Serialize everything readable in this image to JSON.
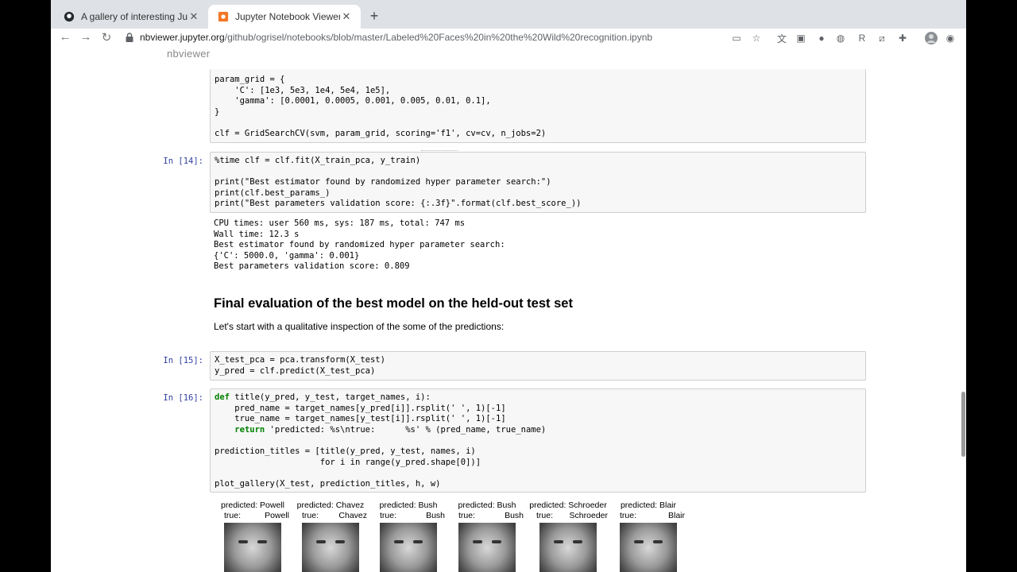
{
  "browser": {
    "tabs": [
      {
        "title": "A gallery of interesting Jupyte",
        "icon": "github-icon",
        "active": false
      },
      {
        "title": "Jupyter Notebook Viewer",
        "icon": "jupyter-icon",
        "active": true
      }
    ],
    "new_tab": "+",
    "close": "✕",
    "nav": {
      "back": "←",
      "forward": "→",
      "reload": "↻"
    },
    "url_host": "nbviewer.jupyter.org",
    "url_path": "/github/ogrisel/notebooks/blob/master/Labeled%20Faces%20in%20the%20Wild%20recognition.ipynb"
  },
  "page": {
    "brand": "nbviewer",
    "cells": {
      "c13_code": "param_grid = {\n    'C': [1e3, 5e3, 1e4, 5e4, 1e5],\n    'gamma': [0.0001, 0.0005, 0.001, 0.005, 0.01, 0.1],\n}\n\nclf = GridSearchCV(svm, param_grid, scoring='f1', cv=cv, n_jobs=2)",
      "c14_prompt": "In [14]:",
      "c14_code": "%time clf = clf.fit(X_train_pca, y_train)\n\nprint(\"Best estimator found by randomized hyper parameter search:\")\nprint(clf.best_params_)\nprint(\"Best parameters validation score: {:.3f}\".format(clf.best_score_))",
      "c14_output": "CPU times: user 560 ms, sys: 187 ms, total: 747 ms\nWall time: 12.3 s\nBest estimator found by randomized hyper parameter search:\n{'C': 5000.0, 'gamma': 0.001}\nBest parameters validation score: 0.809",
      "md_heading": "Final evaluation of the best model on the held-out test set",
      "md_text": "Let's start with a qualitative inspection of the some of the predictions:",
      "c15_prompt": "In [15]:",
      "c15_code": "X_test_pca = pca.transform(X_test)\ny_pred = clf.predict(X_test_pca)",
      "c16_prompt": "In [16]:",
      "c16_kw_def": "def",
      "c16_line1": " title(y_pred, y_test, target_names, i):",
      "c16_line2": "    pred_name = target_names[y_pred[i]].rsplit(' ', 1)[-1]",
      "c16_line3": "    true_name = target_names[y_test[i]].rsplit(' ', 1)[-1]",
      "c16_line4_indent": "    ",
      "c16_kw_return": "return",
      "c16_line4": " 'predicted: %s\\ntrue:      %s' % (pred_name, true_name)",
      "c16_rest": "\nprediction_titles = [title(y_pred, y_test, names, i)\n                     for i in range(y_pred.shape[0])]\n\nplot_gallery(X_test, prediction_titles, h, w)"
    },
    "gallery": [
      {
        "predicted": "predicted: Powell",
        "true_label": "true:",
        "true_name": "Powell"
      },
      {
        "predicted": "predicted: Chavez",
        "true_label": "true:",
        "true_name": "Chavez"
      },
      {
        "predicted": "predicted: Bush",
        "true_label": "true:",
        "true_name": "Bush"
      },
      {
        "predicted": "predicted: Bush",
        "true_label": "true:",
        "true_name": "Bush"
      },
      {
        "predicted": "predicted: Schroeder",
        "true_label": "true:",
        "true_name": "Schroeder"
      },
      {
        "predicted": "predicted: Blair",
        "true_label": "true:",
        "true_name": "Blair"
      }
    ]
  },
  "colors": {
    "prompt": "#303f9f",
    "keyword": "#008000",
    "cell_bg": "#f7f7f7",
    "tabstrip": "#dee1e6"
  }
}
